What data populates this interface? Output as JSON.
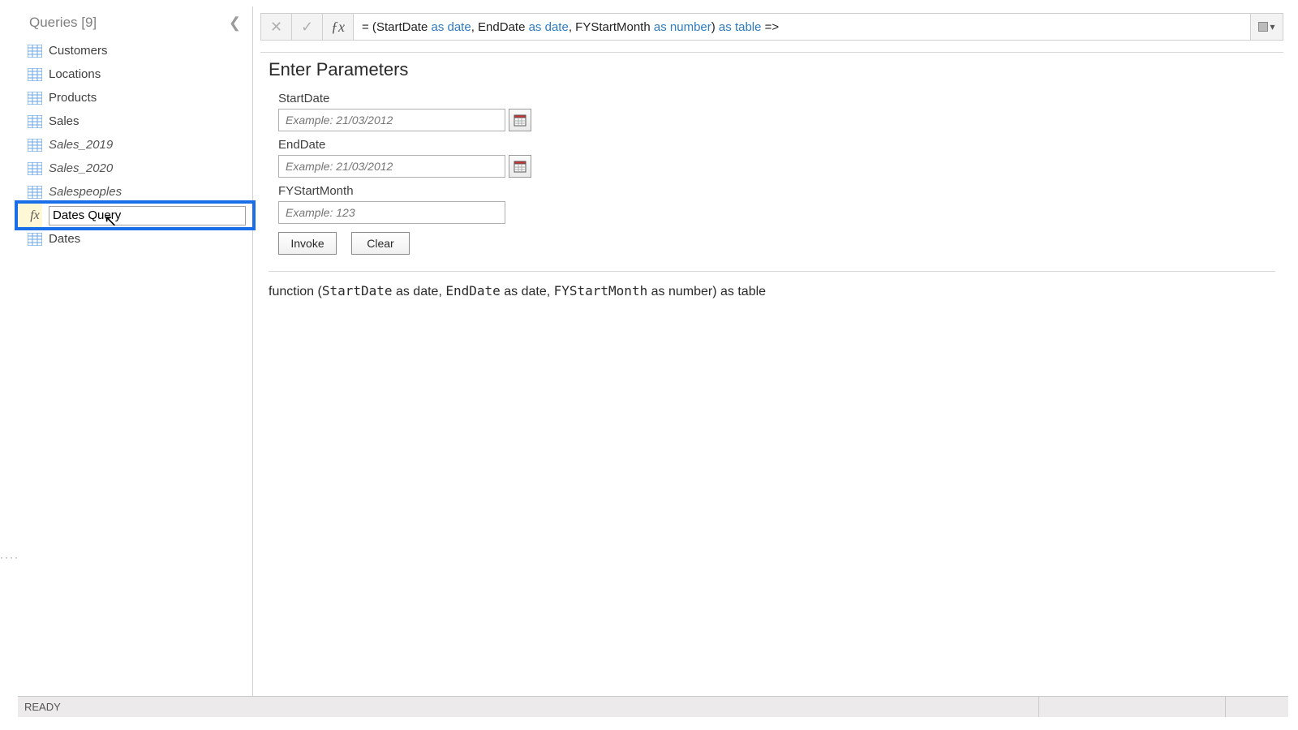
{
  "sidebar": {
    "title": "Queries [9]",
    "items": [
      {
        "label": "Customers",
        "icon": "table",
        "italic": false
      },
      {
        "label": "Locations",
        "icon": "table",
        "italic": false
      },
      {
        "label": "Products",
        "icon": "table",
        "italic": false
      },
      {
        "label": "Sales",
        "icon": "table",
        "italic": false
      },
      {
        "label": "Sales_2019",
        "icon": "table",
        "italic": true
      },
      {
        "label": "Sales_2020",
        "icon": "table",
        "italic": true
      },
      {
        "label": "Salespeoples",
        "icon": "table",
        "italic": true
      },
      {
        "label": "Dates Query",
        "icon": "function",
        "italic": false,
        "editing": true
      },
      {
        "label": "Dates",
        "icon": "table",
        "italic": false
      }
    ],
    "rename_value": "Dates Query"
  },
  "formula_bar": {
    "prefix": "= (",
    "p1_name": "StartDate",
    "p1_as": " as ",
    "p1_type": "date",
    "sep1": ", ",
    "p2_name": "EndDate",
    "p2_as": " as ",
    "p2_type": "date",
    "sep2": ", ",
    "p3_name": "FYStartMonth",
    "p3_as": " as ",
    "p3_type": "number",
    "close": ") ",
    "ret_as": "as ",
    "ret_type": "table",
    "arrow": " =>"
  },
  "params": {
    "heading": "Enter Parameters",
    "start": {
      "label": "StartDate",
      "placeholder": "Example: 21/03/2012"
    },
    "end": {
      "label": "EndDate",
      "placeholder": "Example: 21/03/2012"
    },
    "fy": {
      "label": "FYStartMonth",
      "placeholder": "Example: 123"
    },
    "invoke_label": "Invoke",
    "clear_label": "Clear"
  },
  "signature": {
    "pre": "function (",
    "p1": "StartDate",
    "p1_tail": " as date, ",
    "p2": "EndDate",
    "p2_tail": " as date, ",
    "p3": "FYStartMonth",
    "p3_tail": " as number) as table"
  },
  "statusbar": {
    "text": "READY"
  }
}
